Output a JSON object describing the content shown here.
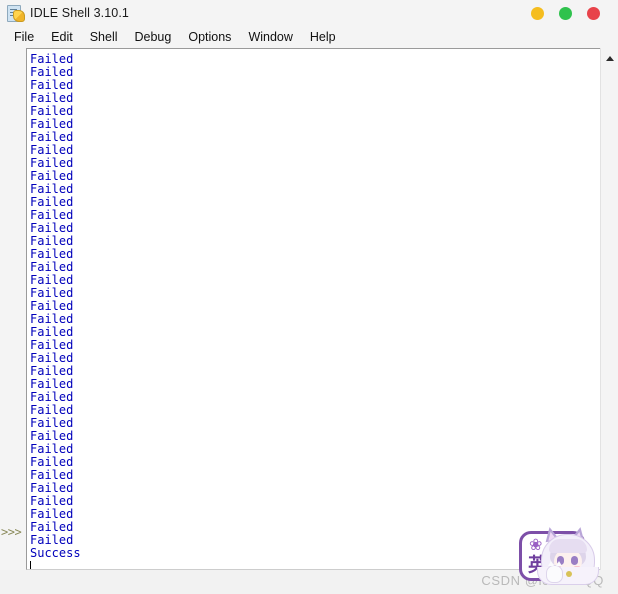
{
  "window": {
    "title": "IDLE Shell 3.10.1",
    "icon": "python-file-icon",
    "controls": [
      {
        "name": "minimize",
        "label": "",
        "color": "#f5bd1f"
      },
      {
        "name": "maximize",
        "label": "",
        "color": "#2fc24d"
      },
      {
        "name": "close",
        "label": "",
        "color": "#e8434a"
      }
    ]
  },
  "menu_bar": {
    "items": [
      {
        "label": "File"
      },
      {
        "label": "Edit"
      },
      {
        "label": "Shell"
      },
      {
        "label": "Debug"
      },
      {
        "label": "Options"
      },
      {
        "label": "Window"
      },
      {
        "label": "Help"
      }
    ]
  },
  "shell": {
    "prompt": ">>>",
    "input_value": "",
    "output_lines": [
      "Failed",
      "Failed",
      "Failed",
      "Failed",
      "Failed",
      "Failed",
      "Failed",
      "Failed",
      "Failed",
      "Failed",
      "Failed",
      "Failed",
      "Failed",
      "Failed",
      "Failed",
      "Failed",
      "Failed",
      "Failed",
      "Failed",
      "Failed",
      "Failed",
      "Failed",
      "Failed",
      "Failed",
      "Failed",
      "Failed",
      "Failed",
      "Failed",
      "Failed",
      "Failed",
      "Failed",
      "Failed",
      "Failed",
      "Failed",
      "Failed",
      "Failed",
      "Failed",
      "Failed",
      "Success"
    ],
    "stdout_color": "#0000bb",
    "prompt_color": "#8a8a5a",
    "background": "#ffffff"
  },
  "scrollbar": {
    "up_arrow": "scroll-up-arrow",
    "orientation": "vertical"
  },
  "overlay": {
    "ime": {
      "butterfly": "❀",
      "mode_char": "英",
      "comma": "，",
      "border_color": "#7d4fa8"
    },
    "watermark": "CSDN @icewolfQQ"
  }
}
